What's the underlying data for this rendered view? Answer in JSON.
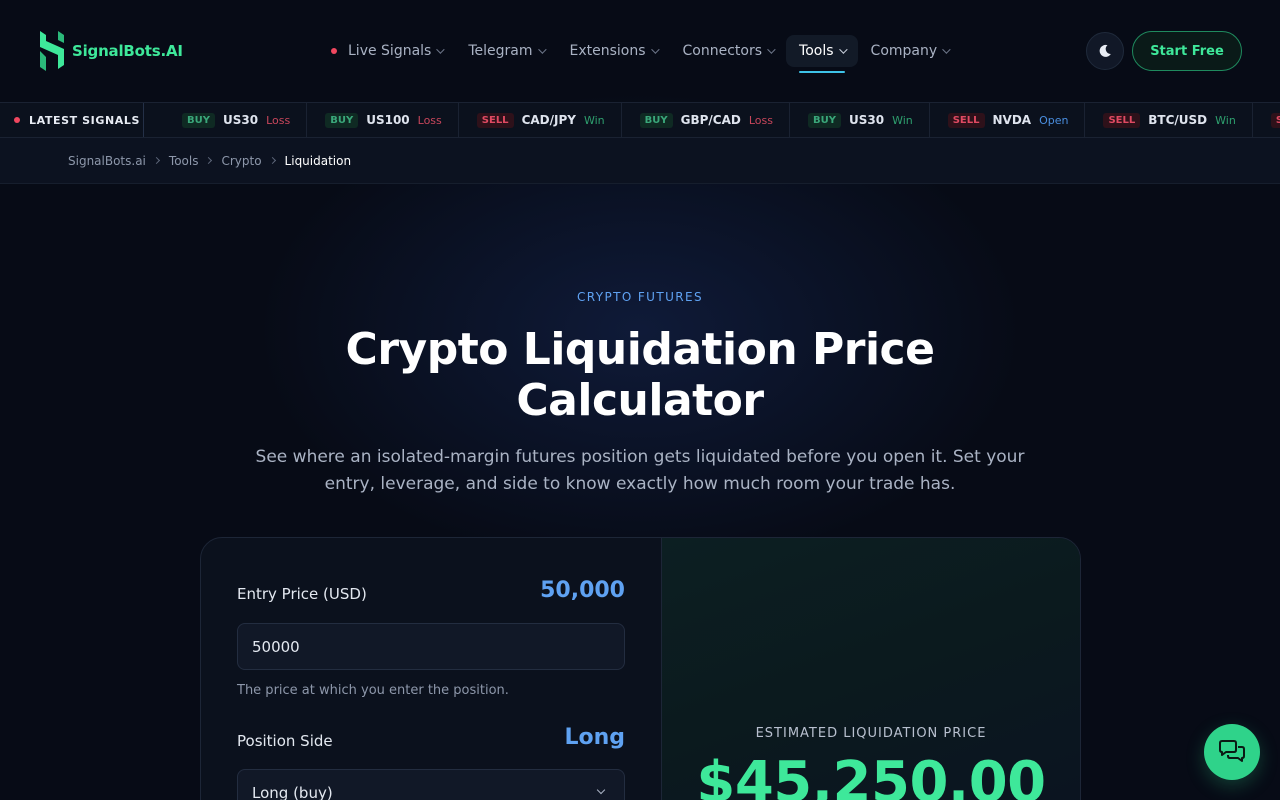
{
  "brand": {
    "name": "SignalBots.AI",
    "accent": "#3ee89a"
  },
  "nav": {
    "items": [
      {
        "label": "Live Signals",
        "live": true
      },
      {
        "label": "Telegram"
      },
      {
        "label": "Extensions"
      },
      {
        "label": "Connectors"
      },
      {
        "label": "Tools",
        "active": true
      },
      {
        "label": "Company"
      }
    ],
    "theme_icon": "moon-icon",
    "cta_label": "Start Free"
  },
  "ticker": {
    "label": "LATEST SIGNALS",
    "items": [
      {
        "side": "BUY",
        "symbol": "US30",
        "result": "Loss"
      },
      {
        "side": "BUY",
        "symbol": "US100",
        "result": "Loss"
      },
      {
        "side": "SELL",
        "symbol": "CAD/JPY",
        "result": "Win"
      },
      {
        "side": "BUY",
        "symbol": "GBP/CAD",
        "result": "Loss"
      },
      {
        "side": "BUY",
        "symbol": "US30",
        "result": "Win"
      },
      {
        "side": "SELL",
        "symbol": "NVDA",
        "result": "Open"
      },
      {
        "side": "SELL",
        "symbol": "BTC/USD",
        "result": "Win"
      },
      {
        "side": "SELL",
        "symbol": "",
        "result": ""
      }
    ]
  },
  "breadcrumb": {
    "items": [
      "SignalBots.ai",
      "Tools",
      "Crypto"
    ],
    "current": "Liquidation"
  },
  "hero": {
    "eyebrow": "CRYPTO FUTURES",
    "title": "Crypto Liquidation Price Calculator",
    "subtitle": "See where an isolated-margin futures position gets liquidated before you open it. Set your entry, leverage, and side to know exactly how much room your trade has."
  },
  "calculator": {
    "entry": {
      "label": "Entry Price (USD)",
      "display": "50,000",
      "value": "50000",
      "help": "The price at which you enter the position."
    },
    "side": {
      "label": "Position Side",
      "display": "Long",
      "selected": "Long (buy)"
    },
    "result": {
      "label": "ESTIMATED LIQUIDATION PRICE",
      "value": "$45,250.00"
    }
  },
  "colors": {
    "buy": "#3aa77a",
    "sell": "#e04a62",
    "win": "#2e9f6e",
    "loss": "#c8465b",
    "open": "#4a8ee0",
    "link_blue": "#5fa2f2"
  },
  "chat_icon": "chat-bubbles-icon"
}
